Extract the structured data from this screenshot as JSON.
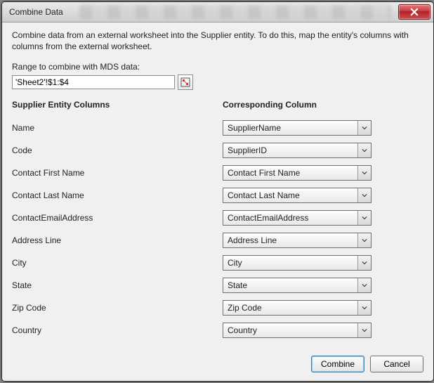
{
  "window": {
    "title": "Combine Data"
  },
  "description": "Combine data from an external worksheet into the Supplier entity. To do this, map the entity's columns with columns from the external worksheet.",
  "range": {
    "label": "Range to combine with MDS data:",
    "value": "'Sheet2'!$1:$4"
  },
  "headers": {
    "left": "Supplier Entity Columns",
    "right": "Corresponding Column"
  },
  "rows": [
    {
      "entity": "Name",
      "selected": "SupplierName"
    },
    {
      "entity": "Code",
      "selected": "SupplierID"
    },
    {
      "entity": "Contact First Name",
      "selected": "Contact First Name"
    },
    {
      "entity": "Contact Last Name",
      "selected": "Contact Last Name"
    },
    {
      "entity": "ContactEmailAddress",
      "selected": "ContactEmailAddress"
    },
    {
      "entity": "Address Line",
      "selected": "Address Line"
    },
    {
      "entity": "City",
      "selected": "City"
    },
    {
      "entity": "State",
      "selected": "State"
    },
    {
      "entity": "Zip Code",
      "selected": "Zip Code"
    },
    {
      "entity": "Country",
      "selected": "Country"
    }
  ],
  "buttons": {
    "combine": "Combine",
    "cancel": "Cancel"
  },
  "icons": {
    "close": "close-icon",
    "rangepicker": "range-picker-icon",
    "dropdown": "chevron-down-icon"
  }
}
